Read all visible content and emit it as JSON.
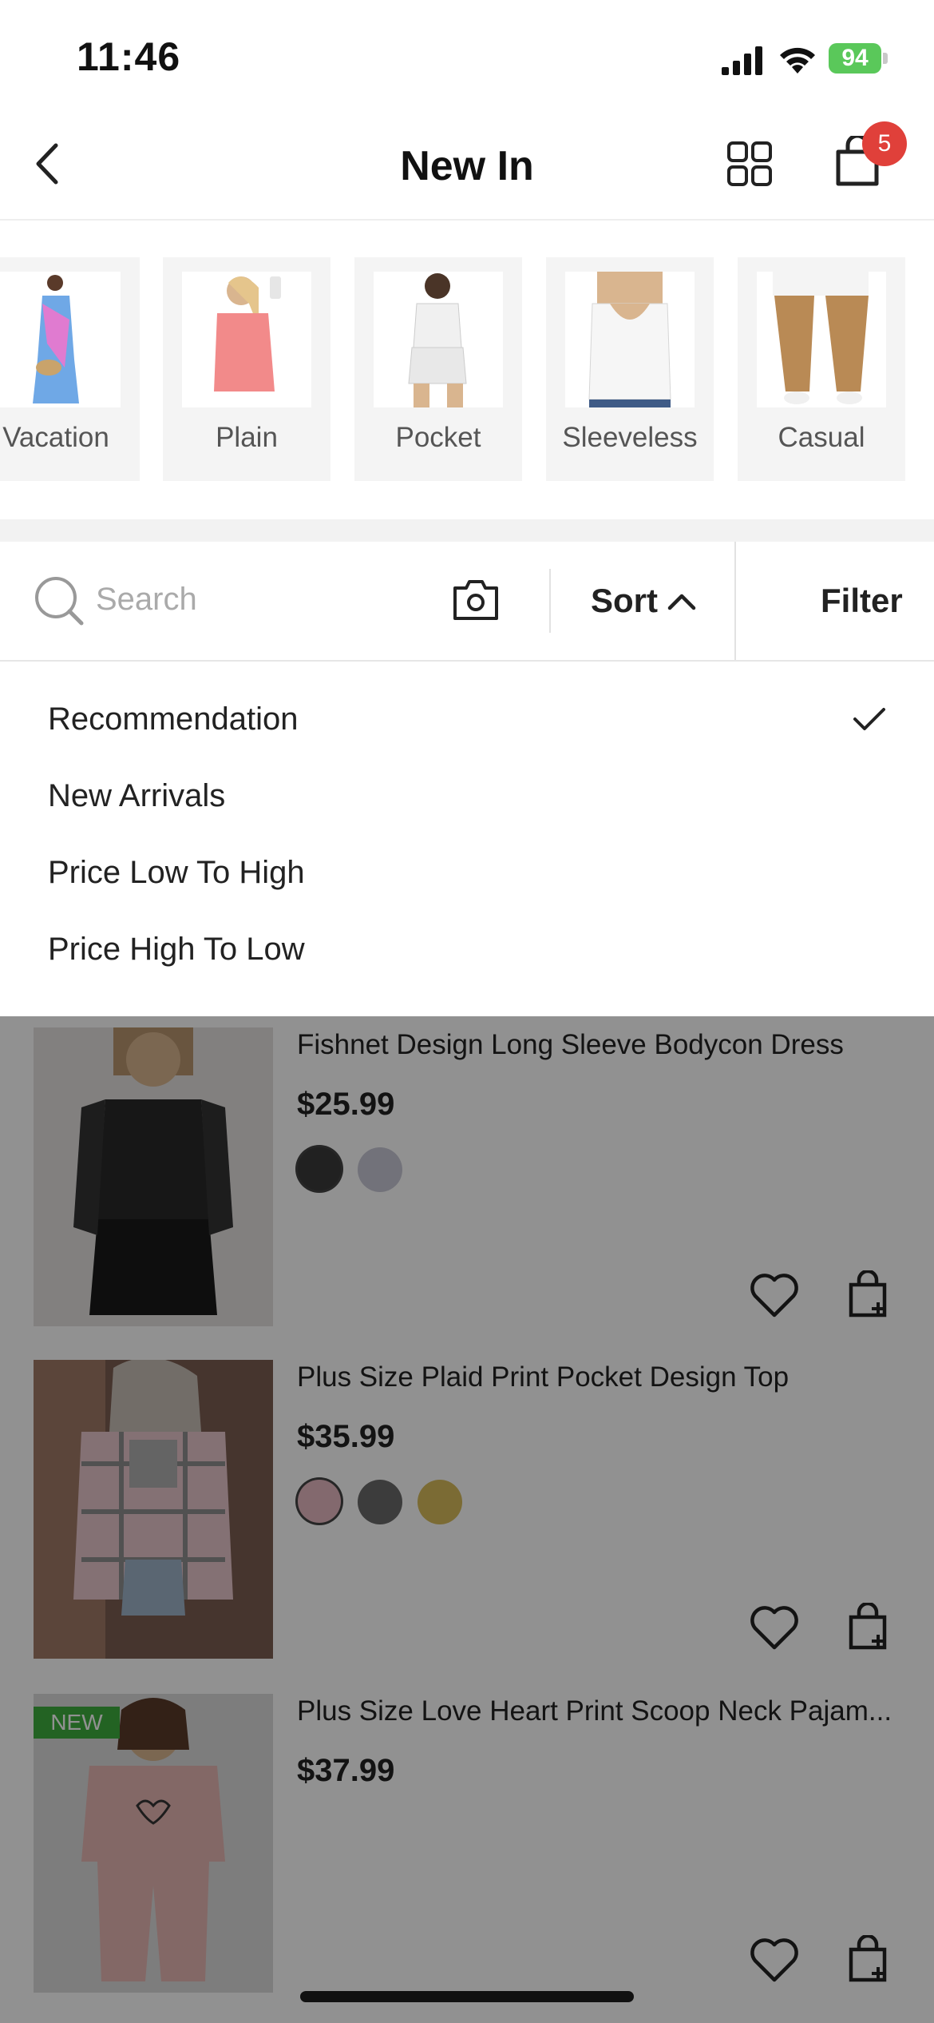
{
  "status_bar": {
    "time": "11:46",
    "battery": "94"
  },
  "nav": {
    "title": "New In",
    "cart_count": "5"
  },
  "categories": [
    {
      "label": "Vacation"
    },
    {
      "label": "Plain"
    },
    {
      "label": "Pocket"
    },
    {
      "label": "Sleeveless"
    },
    {
      "label": "Casual"
    }
  ],
  "toolbar": {
    "search_placeholder": "Search",
    "sort_label": "Sort",
    "filter_label": "Filter"
  },
  "sort_options": [
    {
      "label": "Recommendation",
      "selected": true
    },
    {
      "label": "New Arrivals",
      "selected": false
    },
    {
      "label": "Price Low To High",
      "selected": false
    },
    {
      "label": "Price High To Low",
      "selected": false
    }
  ],
  "products": [
    {
      "title": "Fishnet Design Long Sleeve Bodycon Dress",
      "price": "$25.99",
      "swatches": [
        "#3a3a3a",
        "#c9c9d6"
      ]
    },
    {
      "title": "Plus Size Plaid Print Pocket Design Top",
      "price": "$35.99",
      "swatches": [
        "#e6b9c2",
        "#6a6a6a",
        "#d8bd5c"
      ]
    },
    {
      "title": "Plus Size Love Heart Print Scoop Neck Pajam...",
      "price": "$37.99",
      "badge": "NEW",
      "swatches": []
    }
  ]
}
